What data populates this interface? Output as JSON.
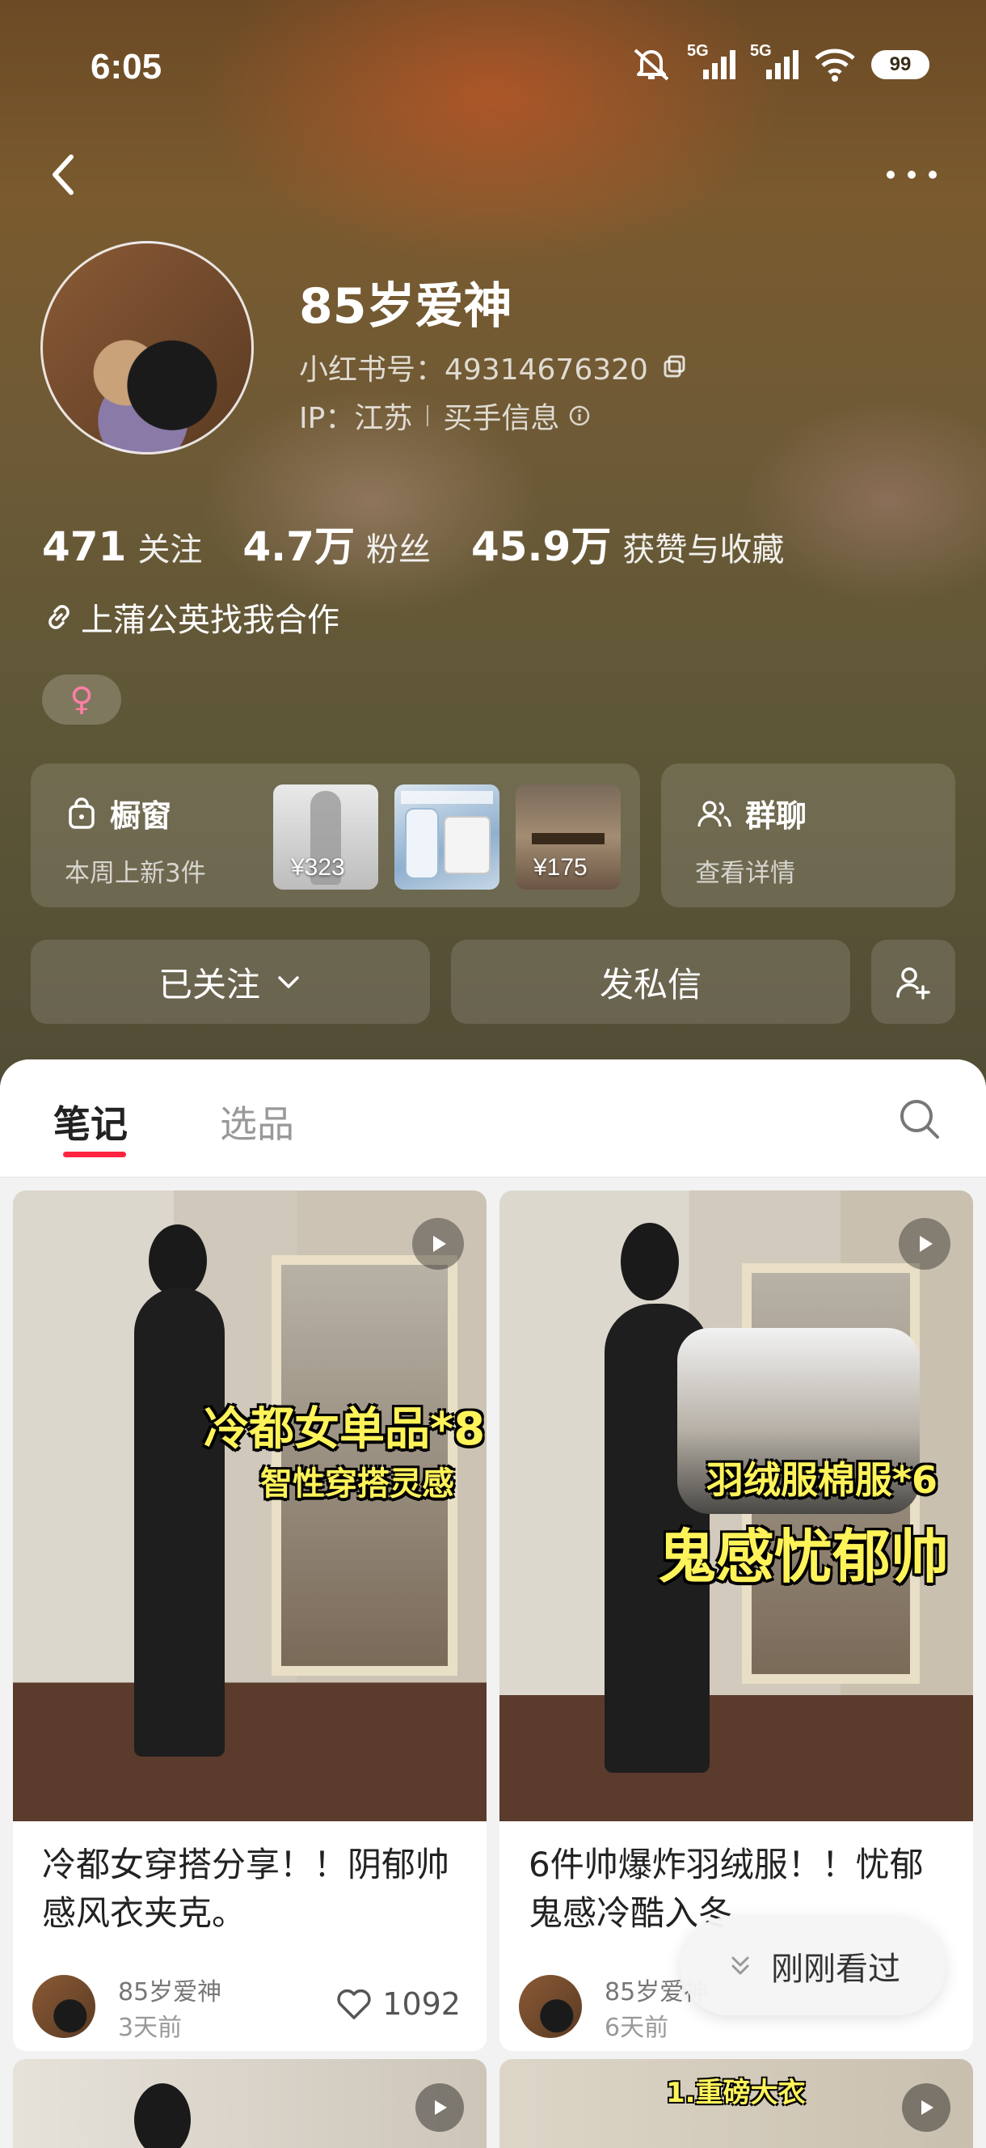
{
  "status_bar": {
    "time": "6:05",
    "network_1": "5G",
    "network_2": "5G",
    "battery": "99"
  },
  "profile": {
    "name": "85岁爱神",
    "id_label": "小红书号：4931467632​0",
    "id_text": "小红书号：49314676320",
    "ip_label": "IP：江苏",
    "buyer_info": "买手信息"
  },
  "stats": [
    {
      "value": "471",
      "label": "关注"
    },
    {
      "value": "4.7万",
      "label": "粉丝"
    },
    {
      "value": "45.9万",
      "label": "获赞与收藏"
    }
  ],
  "collab_link": "上蒲公英找我合作",
  "gender_symbol": "♀",
  "shop": {
    "title": "橱窗",
    "subtitle": "本周上新3件",
    "items": [
      {
        "price": "¥323"
      },
      {
        "price": ""
      },
      {
        "price": "¥175"
      }
    ]
  },
  "group_chat": {
    "title": "群聊",
    "subtitle": "查看详情"
  },
  "actions": {
    "follow": "已关注",
    "message": "发私信"
  },
  "tabs": [
    {
      "label": "笔记",
      "active": true
    },
    {
      "label": "选品",
      "active": false
    }
  ],
  "notes": [
    {
      "overlay_main": "冷都女单品*8",
      "overlay_sub": "智性穿搭灵感",
      "title": "冷都女穿搭分享！！阴郁帅感风衣夹克。",
      "author": "85岁爱神",
      "time": "3天前",
      "likes": "1092"
    },
    {
      "overlay_sub": "羽绒服棉服*6",
      "overlay_main": "鬼感忧郁帅",
      "title": "6件帅爆炸羽绒服！！忧郁鬼感冷酷入冬",
      "author": "85岁爱神",
      "time": "6天前"
    }
  ],
  "next_notes": [
    {
      "overlay": ""
    },
    {
      "overlay": "1.重磅大衣"
    }
  ],
  "recent_pill": "刚刚看过",
  "colors": {
    "accent": "#ff2442",
    "overlay_text": "#fff35a"
  }
}
